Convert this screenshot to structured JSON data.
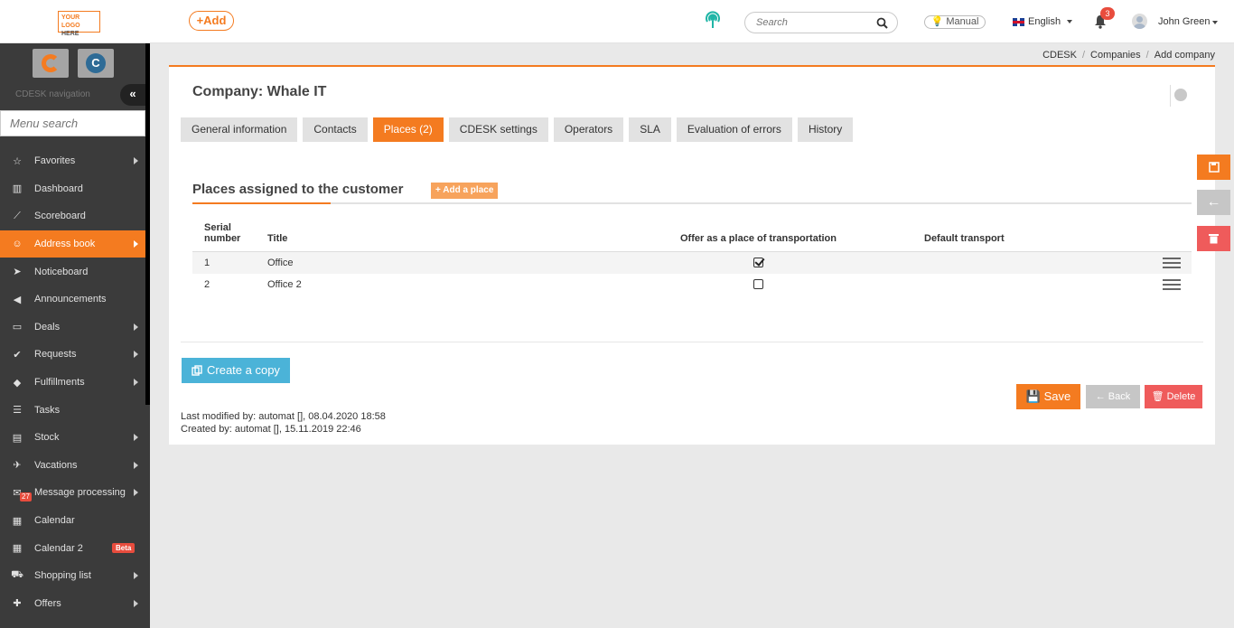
{
  "logo": {
    "line1": "YOUR LOGO",
    "line2": "HERE"
  },
  "header": {
    "add_label": "+Add",
    "search_placeholder": "Search",
    "manual_label": "Manual",
    "language": "English",
    "notifications_count": "3",
    "user_name": "John Green"
  },
  "sidebar": {
    "nav_label": "CDESK navigation",
    "collapse_label": "«",
    "menu_search_placeholder": "Menu search",
    "items": [
      {
        "label": "Favorites",
        "icon": "star-icon",
        "arrow": true
      },
      {
        "label": "Dashboard",
        "icon": "bar-chart-icon",
        "arrow": false
      },
      {
        "label": "Scoreboard",
        "icon": "line-chart-icon",
        "arrow": false
      },
      {
        "label": "Address book",
        "icon": "user-icon",
        "arrow": true,
        "active": true
      },
      {
        "label": "Noticeboard",
        "icon": "paper-plane-icon",
        "arrow": false
      },
      {
        "label": "Announcements",
        "icon": "megaphone-icon",
        "arrow": false
      },
      {
        "label": "Deals",
        "icon": "credit-card-icon",
        "arrow": true
      },
      {
        "label": "Requests",
        "icon": "check-circle-icon",
        "arrow": true
      },
      {
        "label": "Fulfillments",
        "icon": "cube-icon",
        "arrow": true
      },
      {
        "label": "Tasks",
        "icon": "tasks-icon",
        "arrow": false
      },
      {
        "label": "Stock",
        "icon": "archive-icon",
        "arrow": true
      },
      {
        "label": "Vacations",
        "icon": "plane-icon",
        "arrow": true
      },
      {
        "label": "Message processing",
        "icon": "envelope-icon",
        "arrow": true,
        "badge": "27"
      },
      {
        "label": "Calendar",
        "icon": "calendar-icon",
        "arrow": false
      },
      {
        "label": "Calendar 2",
        "icon": "calendar-icon",
        "arrow": false,
        "beta": "Beta"
      },
      {
        "label": "Shopping list",
        "icon": "cart-icon",
        "arrow": true
      },
      {
        "label": "Offers",
        "icon": "gift-icon",
        "arrow": true
      }
    ]
  },
  "breadcrumb": [
    "CDESK",
    "Companies",
    "Add company"
  ],
  "page": {
    "title": "Company: Whale IT",
    "tabs": [
      "General information",
      "Contacts",
      "Places (2)",
      "CDESK settings",
      "Operators",
      "SLA",
      "Evaluation of errors",
      "History"
    ],
    "active_tab": 2,
    "section_title": "Places assigned to the customer",
    "add_place_label": "+ Add a place",
    "table": {
      "headers": [
        "Serial number",
        "Title",
        "Offer as a place of transportation",
        "Default transport"
      ],
      "rows": [
        {
          "serial": "1",
          "title": "Office",
          "offer": true
        },
        {
          "serial": "2",
          "title": "Office 2",
          "offer": false
        }
      ]
    },
    "create_copy_label": "Create a copy",
    "save_label": "Save",
    "back_label": "← Back",
    "delete_label": "Delete",
    "last_modified": "Last modified by: automat  [], 08.04.2020 18:58",
    "created": "Created by: automat  [], 15.11.2019 22:46"
  },
  "colors": {
    "accent": "#f47b20",
    "sidebar": "#3b3b3b",
    "info": "#4bb3d8",
    "danger": "#ef5b5b"
  }
}
